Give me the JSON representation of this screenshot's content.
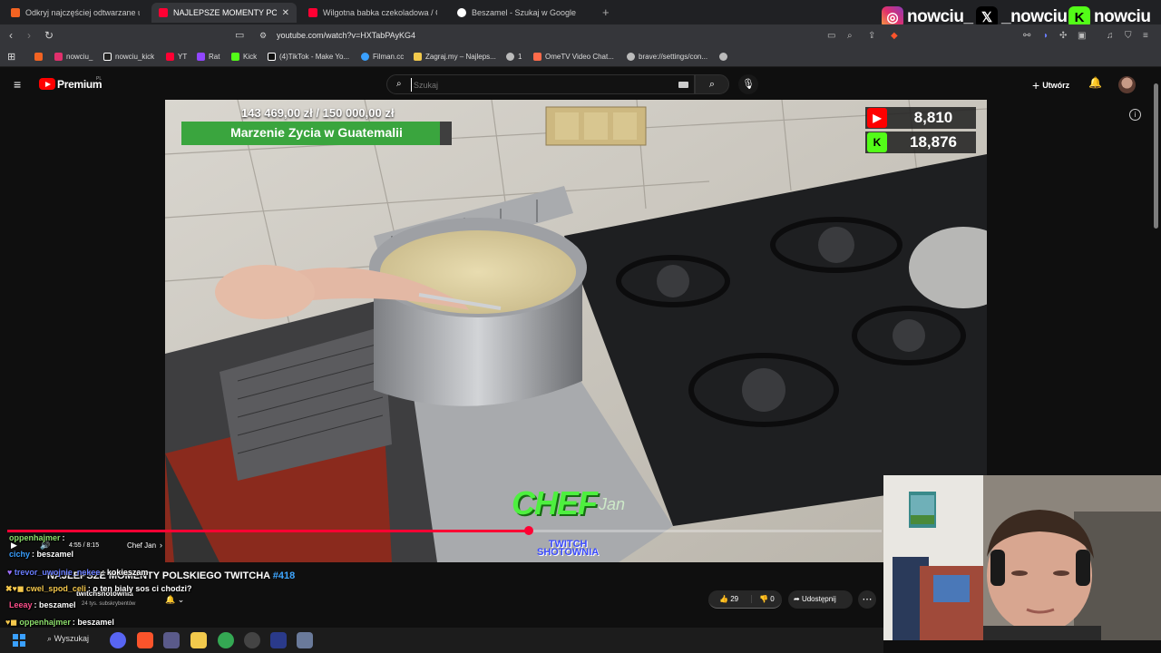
{
  "browser": {
    "tabs": [
      {
        "label": "Odkryj najczęściej odtwarzane utwory",
        "active": false,
        "icon": "music-app-icon",
        "color": "#f26322"
      },
      {
        "label": "NAJLEPSZE MOMENTY POLSKIEGO TWITCHA",
        "active": true,
        "icon": "youtube-icon",
        "color": "#ff0033"
      },
      {
        "label": "Wilgotna babka czekoladowa / Odda",
        "active": false,
        "icon": "youtube-icon",
        "color": "#ff0033"
      },
      {
        "label": "Beszamel - Szukaj w Google",
        "active": false,
        "icon": "google-icon",
        "color": "#ffffff"
      }
    ],
    "url": "youtube.com/watch?v=HXTabPAyKG4",
    "bookmarks": [
      {
        "label": "nowciu_",
        "icon": "instagram-icon",
        "color": "#e1306c"
      },
      {
        "label": "nowciu_kick",
        "icon": "x-icon",
        "color": "#ffffff"
      },
      {
        "label": "YT",
        "icon": "youtube-icon",
        "color": "#ff0033"
      },
      {
        "label": "Rat",
        "icon": "twitch-icon",
        "color": "#9146ff"
      },
      {
        "label": "Kick",
        "icon": "kick-icon",
        "color": "#53fc18"
      },
      {
        "label": "(4)TikTok - Make Yo...",
        "icon": "tiktok-icon",
        "color": "#ffffff"
      },
      {
        "label": "Filman.cc",
        "icon": "film-icon",
        "color": "#3aa0ff"
      },
      {
        "label": "Zagraj.my – Najleps...",
        "icon": "game-icon",
        "color": "#f2c94c"
      },
      {
        "label": "1",
        "icon": "site-icon",
        "color": "#bbbbbb"
      },
      {
        "label": "OmeTV Video Chat...",
        "icon": "video-chat-icon",
        "color": "#ff6b4a"
      },
      {
        "label": "brave://settings/con...",
        "icon": "settings-icon",
        "color": "#bbbbbb"
      }
    ]
  },
  "social": {
    "instagram": "nowciu_",
    "x": "_nowciu",
    "kick": "nowciu"
  },
  "youtube": {
    "logo_text": "Premium",
    "region": "PL",
    "search_placeholder": "Szukaj",
    "create_label": "Utwórz"
  },
  "stream_overlay": {
    "goal_current": "143 469,00 zł",
    "goal_target": "/ 150 000,00 zł",
    "goal_title": "Marzenie Zycia w Guatemalii",
    "goal_progress": 0.956,
    "youtube_count": "8,810",
    "kick_count": "18,876",
    "chef_logo": "CHEF",
    "chef_script": "Jan",
    "watermark_line1": "TWITCH",
    "watermark_line2": "SHOTOWNIA"
  },
  "player": {
    "time": "4:55 / 8:15",
    "chapter": "Chef Jan",
    "progress": 0.596
  },
  "video": {
    "title": "NAJLEPSZE MOMENTY POLSKIEGO TWITCHA",
    "episode": "#418",
    "channel": "twitchshotownia",
    "subscribers": "24 tys. subskrybentów",
    "likes": "29",
    "dislikes": "0",
    "share_label": "Udostępnij"
  },
  "chat": [
    {
      "user": "oppenhajmer",
      "text": ":",
      "color": "#8bdc6a"
    },
    {
      "user": "cichy",
      "text": ": beszamel",
      "color": "#3aa0ff"
    },
    {
      "user": "trevor_uwojnie_nekee",
      "text": ": kokieszam",
      "color": "#6a7dff"
    },
    {
      "user": "cwel_spod_celi",
      "text": ": o ten bialy sos ci chodzi?",
      "color": "#f5c84c"
    },
    {
      "user": "Leeay",
      "text": ": beszamel",
      "color": "#ff4f8b"
    },
    {
      "user": "oppenhajmer",
      "text": ": beszamel",
      "color": "#8bdc6a"
    }
  ],
  "taskbar": {
    "search_label": "Wyszukaj"
  }
}
